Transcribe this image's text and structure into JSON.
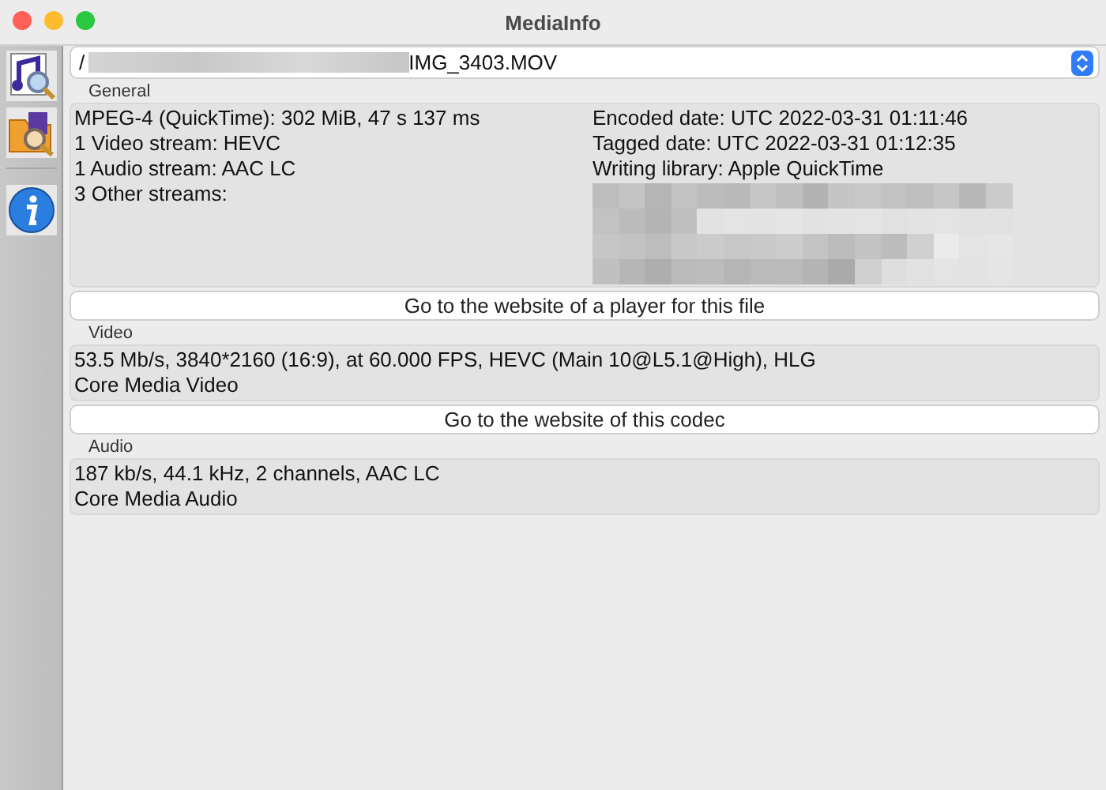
{
  "window": {
    "title": "MediaInfo"
  },
  "file_selector": {
    "path_start": "/",
    "file_name": "IMG_3403.MOV"
  },
  "sections": [
    {
      "heading": "General",
      "kind": "two_column",
      "left_lines": [
        "MPEG-4 (QuickTime): 302 MiB, 47 s 137 ms",
        "1 Video stream: HEVC",
        "1 Audio stream: AAC LC",
        "3 Other streams:"
      ],
      "right_lines": [
        "Encoded date: UTC 2022-03-31 01:11:46",
        "Tagged date: UTC 2022-03-31 01:12:35",
        "Writing library: Apple QuickTime"
      ],
      "button": "Go to the website of a player for this file"
    },
    {
      "heading": "Video",
      "kind": "single",
      "lines": [
        "53.5 Mb/s, 3840*2160 (16:9), at 60.000 FPS, HEVC (Main 10@L5.1@High), HLG",
        "Core Media Video"
      ],
      "button": "Go to the website of this codec"
    },
    {
      "heading": "Audio",
      "kind": "single",
      "lines": [
        "187 kb/s, 44.1 kHz, 2 channels, AAC LC",
        "Core Media Audio"
      ]
    }
  ]
}
